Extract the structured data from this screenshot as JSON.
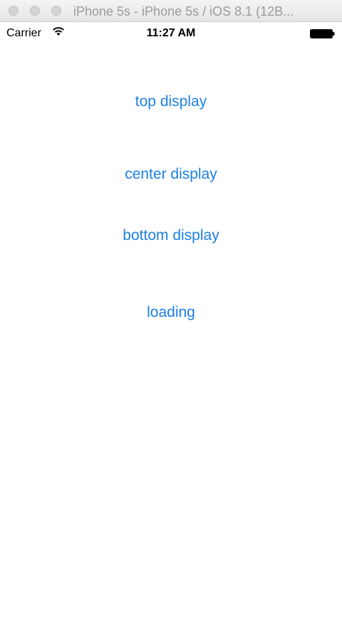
{
  "window": {
    "title": "iPhone 5s - iPhone 5s / iOS 8.1 (12B..."
  },
  "status_bar": {
    "carrier": "Carrier",
    "time": "11:27 AM",
    "icons": [
      "wifi-icon",
      "battery-icon"
    ]
  },
  "main": {
    "buttons": [
      {
        "label": "top display"
      },
      {
        "label": "center display"
      },
      {
        "label": "bottom display"
      },
      {
        "label": "loading"
      }
    ]
  },
  "colors": {
    "accent": "#1d80e6",
    "title_text": "#9b9b9b"
  }
}
